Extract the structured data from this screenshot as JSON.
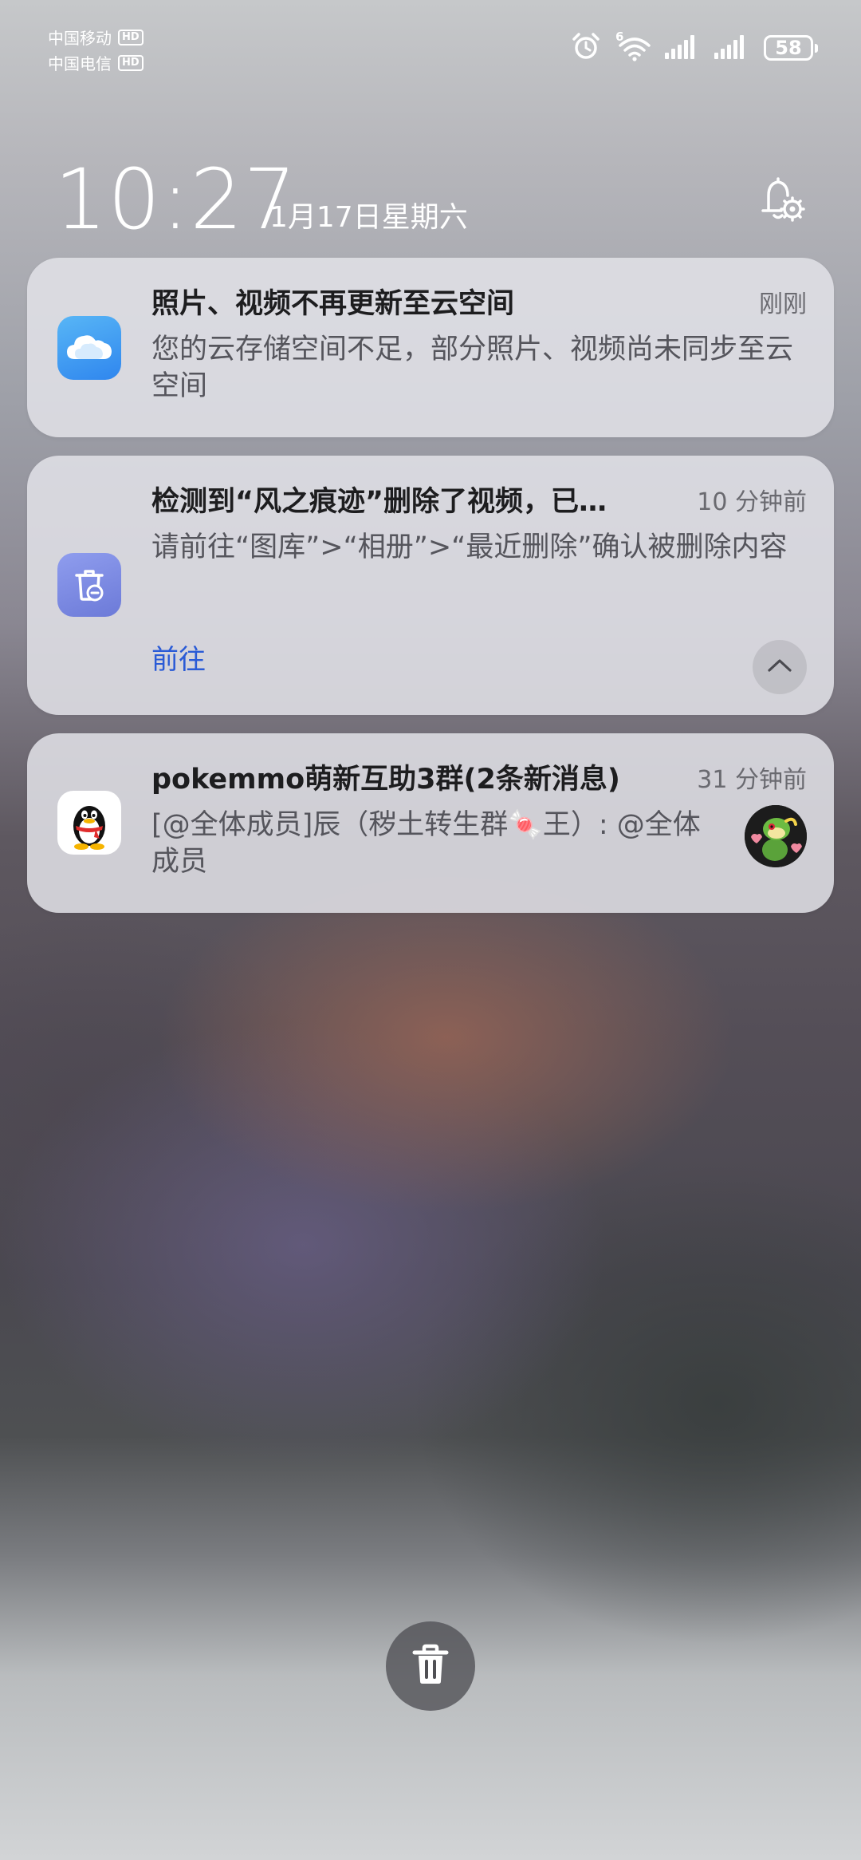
{
  "status_bar": {
    "carrier1": "中国移动",
    "carrier2": "中国电信",
    "hd_badge": "HD",
    "wifi_label": "6",
    "battery_level": "58",
    "icons": [
      "alarm-clock-icon",
      "wifi-6-icon",
      "signal-icon",
      "signal-icon",
      "battery-icon"
    ]
  },
  "lockscreen": {
    "time": "10:27",
    "date": "1月17日星期六"
  },
  "notifications": [
    {
      "app_icon": "cloud-icon",
      "title": "照片、视频不再更新至云空间",
      "time": "刚刚",
      "body": "您的云存储空间不足，部分照片、视频尚未同步至云空间"
    },
    {
      "app_icon": "recycle-bin-icon",
      "title": "检测到“风之痕迹”删除了视频，已…",
      "time": "10 分钟前",
      "body": "请前往“图库”>“相册”>“最近删除”确认被删除内容",
      "action": "前往"
    },
    {
      "app_icon": "qq-penguin-icon",
      "title": "pokemmo萌新互助3群(2条新消息)",
      "time": "31 分钟前",
      "body": "[@全体成员]辰（秽土转生群🍬王）: @全体成员"
    }
  ],
  "colors": {
    "card_bg": "#e2e2e8",
    "link": "#2a5bd6",
    "title": "#1d1d1f",
    "body": "#55555c"
  }
}
